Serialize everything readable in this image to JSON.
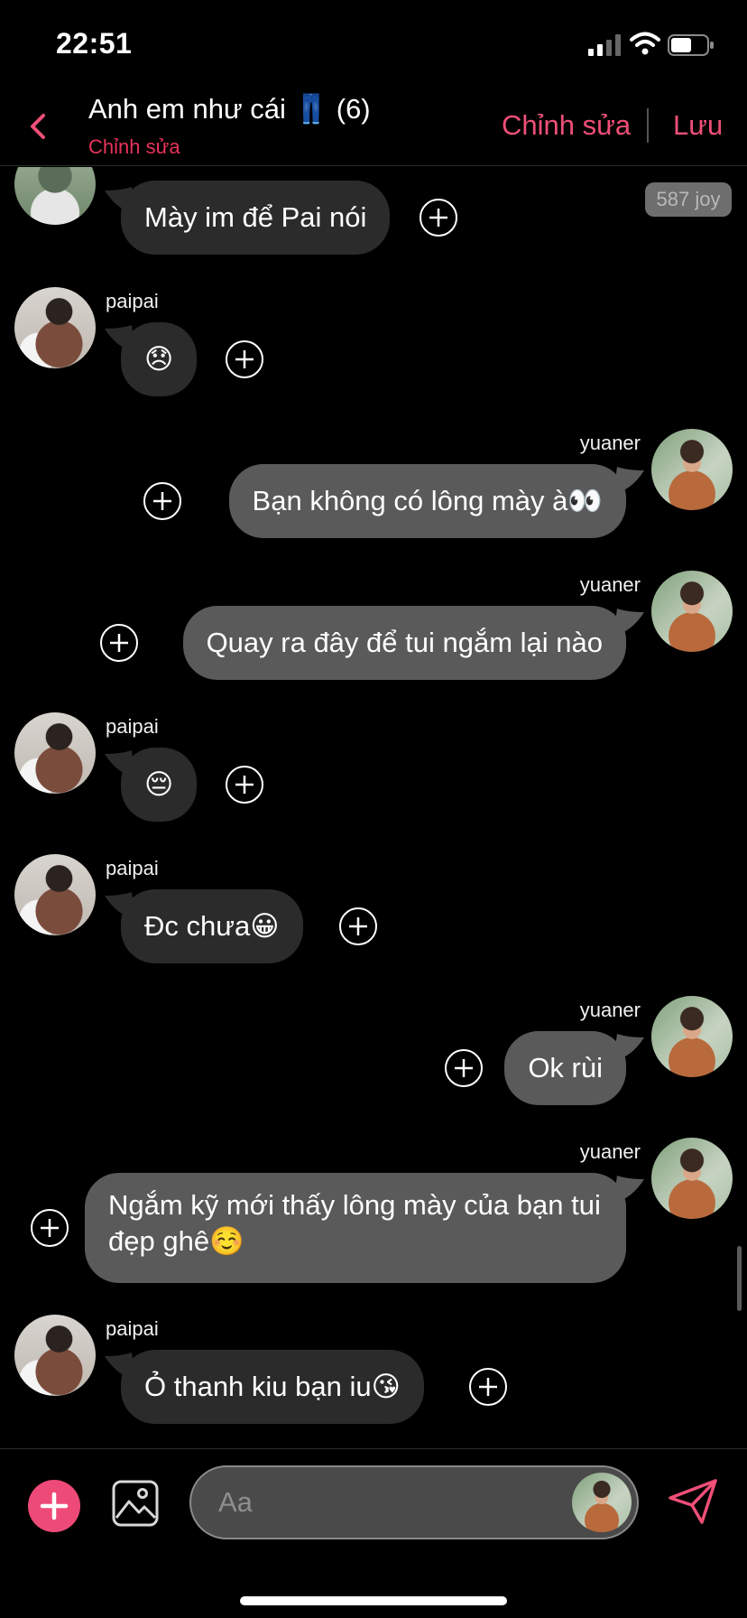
{
  "status_bar": {
    "time": "22:51"
  },
  "header": {
    "title": "Anh em như cái 👖 (6)",
    "subtitle": "Chỉnh sửa",
    "edit_label": "Chỉnh sửa",
    "save_label": "Lưu"
  },
  "badge": {
    "joy": "587 joy"
  },
  "messages": [
    {
      "sender": "",
      "text": "Mày im để Pai nói",
      "direction": "incoming"
    },
    {
      "sender": "paipai",
      "text": "😞",
      "direction": "incoming"
    },
    {
      "sender": "yuaner",
      "text": "Bạn không có lông mày à👀",
      "direction": "outgoing"
    },
    {
      "sender": "yuaner",
      "text": "Quay ra đây để tui ngắm lại nào",
      "direction": "outgoing"
    },
    {
      "sender": "paipai",
      "text": "😔",
      "direction": "incoming"
    },
    {
      "sender": "paipai",
      "text": "Đc chưa😀",
      "direction": "incoming"
    },
    {
      "sender": "yuaner",
      "text": "Ok rùi",
      "direction": "outgoing"
    },
    {
      "sender": "yuaner",
      "text": "Ngắm kỹ mới thấy lông mày của bạn tui đẹp ghê☺️",
      "direction": "outgoing"
    },
    {
      "sender": "paipai",
      "text": "Ỏ thanh kiu bạn iu😘",
      "direction": "incoming"
    }
  ],
  "composer": {
    "placeholder": "Aa"
  },
  "colors": {
    "accent": "#ef4f78",
    "incoming_bubble": "#2b2b2b",
    "outgoing_bubble": "#5a5a5a",
    "background": "#000000"
  },
  "icons": [
    "back-icon",
    "plus-circle-icon",
    "add-icon",
    "image-icon",
    "send-icon",
    "signal-icon",
    "wifi-icon",
    "battery-icon"
  ]
}
